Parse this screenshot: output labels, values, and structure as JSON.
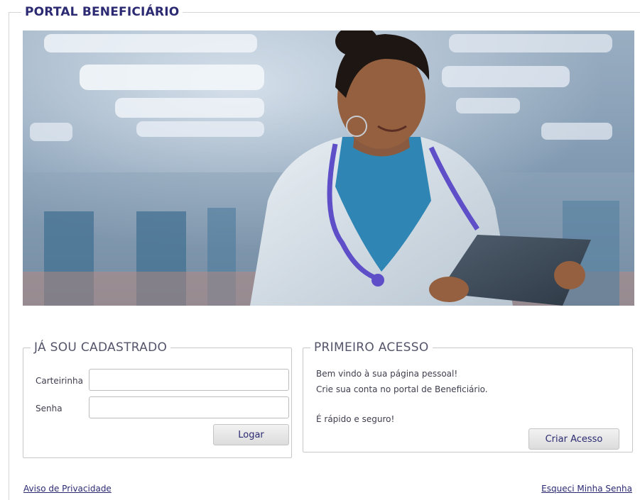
{
  "portal": {
    "title": "PORTAL BENEFICIÁRIO"
  },
  "hero": {
    "image": "doctor-with-tablet-hero-photo"
  },
  "login": {
    "legend": "JÁ SOU CADASTRADO",
    "card_label": "Carteirinha",
    "card_value": "",
    "password_label": "Senha",
    "password_value": "",
    "submit_label": "Logar"
  },
  "first_access": {
    "legend": "PRIMEIRO ACESSO",
    "line1": "Bem vindo à sua página pessoal!",
    "line2": "Crie sua conta no portal de Beneficiário.",
    "line3": "É rápido e seguro!",
    "button_label": "Criar Acesso"
  },
  "footer": {
    "privacy_link": "Aviso de Privacidade",
    "forgot_link": "Esqueci Minha Senha"
  },
  "colors": {
    "brand": "#2b2a72",
    "border": "#c9c9c9",
    "text": "#3e3e4e"
  }
}
